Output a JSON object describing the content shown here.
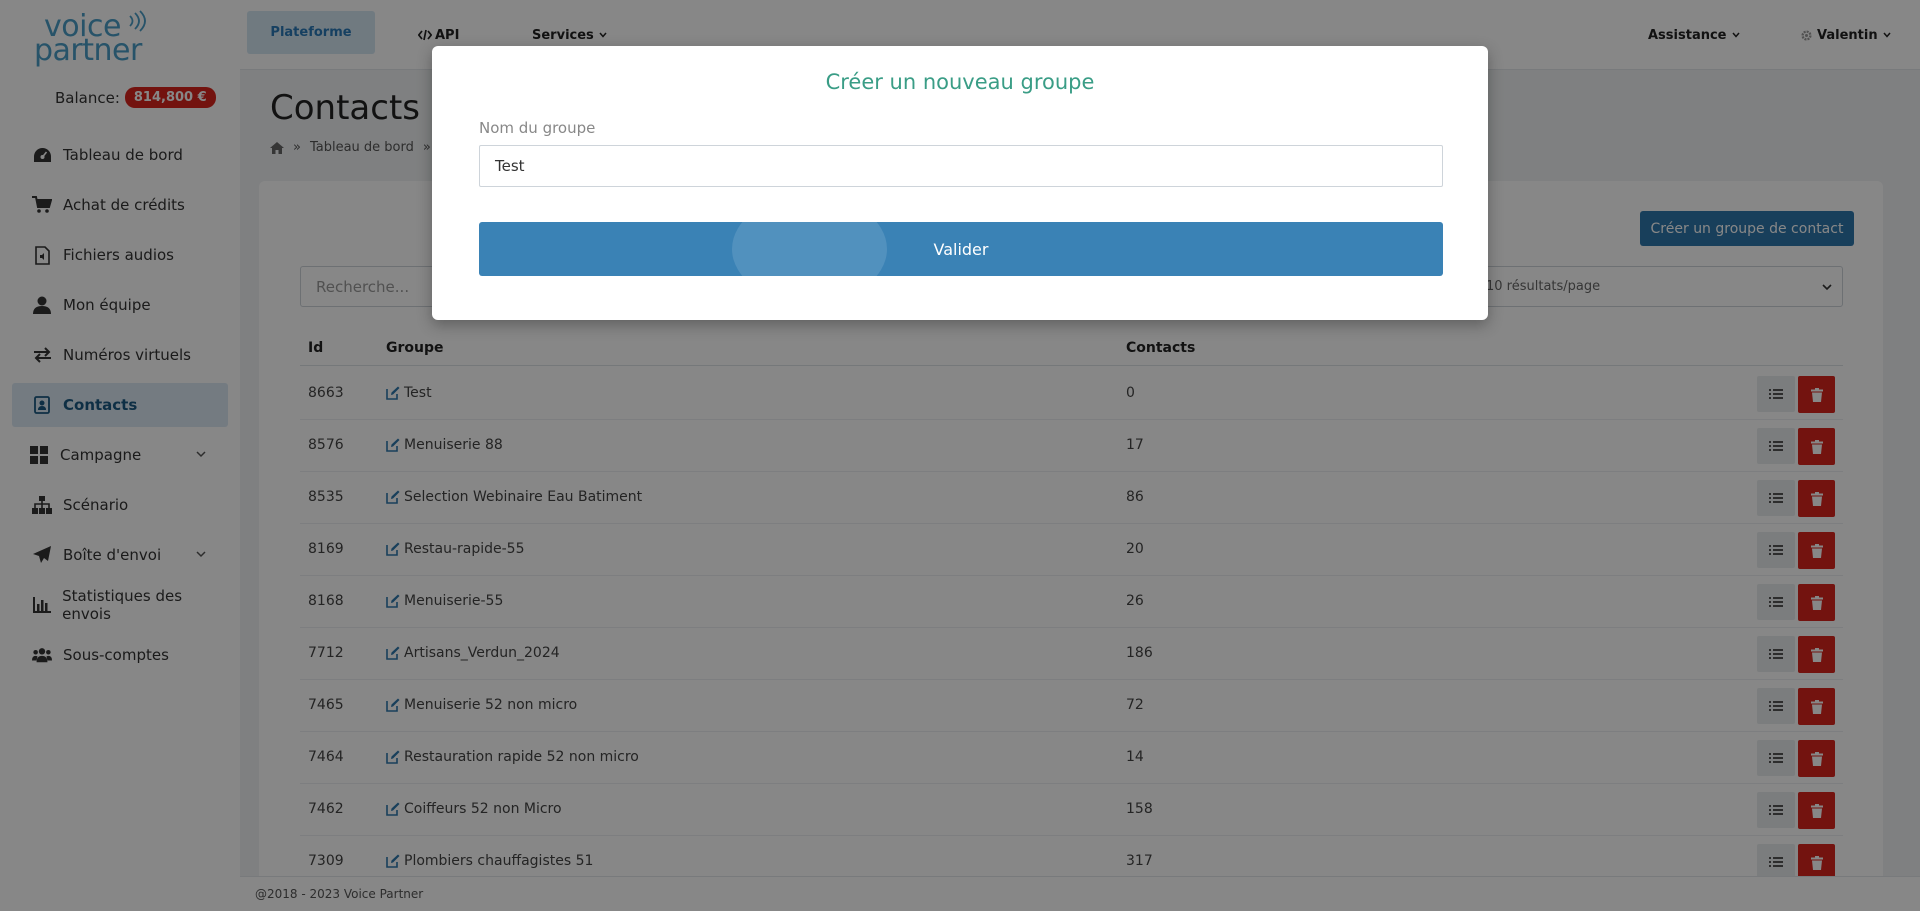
{
  "brand": {
    "line1": "voice",
    "line2": "partner"
  },
  "balance": {
    "label": "Balance:",
    "amount": "814,800 €"
  },
  "sidebar": {
    "items": [
      {
        "label": "Tableau de bord",
        "icon": "gauge-icon"
      },
      {
        "label": "Achat de crédits",
        "icon": "cart-icon"
      },
      {
        "label": "Fichiers audios",
        "icon": "audio-file-icon"
      },
      {
        "label": "Mon équipe",
        "icon": "user-icon"
      },
      {
        "label": "Numéros virtuels",
        "icon": "exchange-icon"
      },
      {
        "label": "Contacts",
        "icon": "address-book-icon",
        "active": true
      },
      {
        "label": "Campagne",
        "icon": "grid-icon",
        "expandable": true
      },
      {
        "label": "Scénario",
        "icon": "sitemap-icon"
      },
      {
        "label": "Boîte d'envoi",
        "icon": "paper-plane-icon",
        "expandable": true
      },
      {
        "label": "Statistiques des envois",
        "icon": "bar-chart-icon"
      },
      {
        "label": "Sous-comptes",
        "icon": "users-icon"
      }
    ]
  },
  "topnav": {
    "platform": "Plateforme",
    "api": "API",
    "services": "Services",
    "assistance": "Assistance",
    "user": "Valentin"
  },
  "page": {
    "title": "Contacts",
    "breadcrumb": {
      "sep": "»",
      "dashboard": "Tableau de bord",
      "sep2": "»"
    }
  },
  "toolbar": {
    "create_group_button": "Créer un groupe de contact",
    "search_placeholder": "Recherche...",
    "per_page": "10 résultats/page"
  },
  "table": {
    "headers": {
      "id": "Id",
      "group": "Groupe",
      "contacts": "Contacts"
    },
    "rows": [
      {
        "id": "8663",
        "group": "Test",
        "contacts": "0"
      },
      {
        "id": "8576",
        "group": "Menuiserie 88",
        "contacts": "17"
      },
      {
        "id": "8535",
        "group": "Selection Webinaire Eau Batiment",
        "contacts": "86"
      },
      {
        "id": "8169",
        "group": "Restau-rapide-55",
        "contacts": "20"
      },
      {
        "id": "8168",
        "group": "Menuiserie-55",
        "contacts": "26"
      },
      {
        "id": "7712",
        "group": "Artisans_Verdun_2024",
        "contacts": "186"
      },
      {
        "id": "7465",
        "group": "Menuiserie 52 non micro",
        "contacts": "72"
      },
      {
        "id": "7464",
        "group": "Restauration rapide 52 non micro",
        "contacts": "14"
      },
      {
        "id": "7462",
        "group": "Coiffeurs 52 non Micro",
        "contacts": "158"
      },
      {
        "id": "7309",
        "group": "Plombiers chauffagistes 51",
        "contacts": "317"
      }
    ]
  },
  "footer": {
    "text": "@2018 - 2023 Voice Partner"
  },
  "modal": {
    "title": "Créer un nouveau groupe",
    "field_label": "Nom du groupe",
    "field_value": "Test",
    "submit": "Valider"
  },
  "colors": {
    "accent": "#2e78ad",
    "danger": "#d9251d",
    "modal_title": "#3a9d86",
    "active_nav_bg": "#dce9f3"
  }
}
